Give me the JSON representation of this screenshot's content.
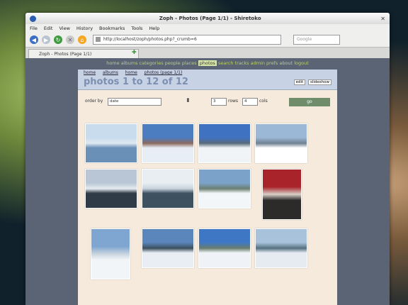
{
  "window": {
    "title": "Zoph - Photos (Page 1/1) - Shiretoko"
  },
  "menu": [
    "File",
    "Edit",
    "View",
    "History",
    "Bookmarks",
    "Tools",
    "Help"
  ],
  "navbar": {
    "url": "http://localhost/zoph/photos.php?_crumb=6",
    "search_placeholder": "Google"
  },
  "tab": {
    "label": "Zoph - Photos (Page 1/1)"
  },
  "topnav": {
    "before": "home albums categories people places",
    "current": "photos",
    "after": "search tracks admin prefs about logout"
  },
  "breadcrumbs": [
    "home",
    "albums",
    "home",
    "photos (page 1/1)"
  ],
  "page": {
    "heading": "photos 1 to 12 of 12",
    "links": [
      "edit",
      "slideshow"
    ]
  },
  "controls": {
    "order_label": "order by",
    "order_value": "date",
    "rows": "3",
    "rows_label": "rows",
    "cols": "4",
    "cols_label": "cols",
    "go_label": "go"
  },
  "photos": [
    {
      "colors": [
        "#c8dced",
        "#6a90b8",
        "#dfe8f0"
      ]
    },
    {
      "colors": [
        "#4c7dc0",
        "#e8eef5",
        "#8c6a60"
      ]
    },
    {
      "colors": [
        "#3f73c2",
        "#f1f4f7",
        "#5a6b7a"
      ]
    },
    {
      "colors": [
        "#9bb8d6",
        "#ffffff",
        "#6e8191"
      ]
    },
    {
      "colors": [
        "#b8c6d6",
        "#2f3b46",
        "#e6ebf0"
      ]
    },
    {
      "colors": [
        "#e9eef3",
        "#3d5160",
        "#c7d2dc"
      ]
    },
    {
      "colors": [
        "#7ba3c9",
        "#f3f6f9",
        "#6b7f71"
      ]
    },
    {
      "colors": [
        "#a8242a",
        "#2d2a2a",
        "#d8cfc8"
      ]
    },
    {
      "colors": [
        "#7ea6d0",
        "#f2f5f8",
        "#c9d4de"
      ]
    },
    {
      "colors": [
        "#5b86bb",
        "#e8eef4",
        "#3c4f5e"
      ]
    },
    {
      "colors": [
        "#3e78c4",
        "#eff3f7",
        "#6a7c6e"
      ]
    },
    {
      "colors": [
        "#a9c2db",
        "#e5ebf1",
        "#55707f"
      ]
    }
  ]
}
